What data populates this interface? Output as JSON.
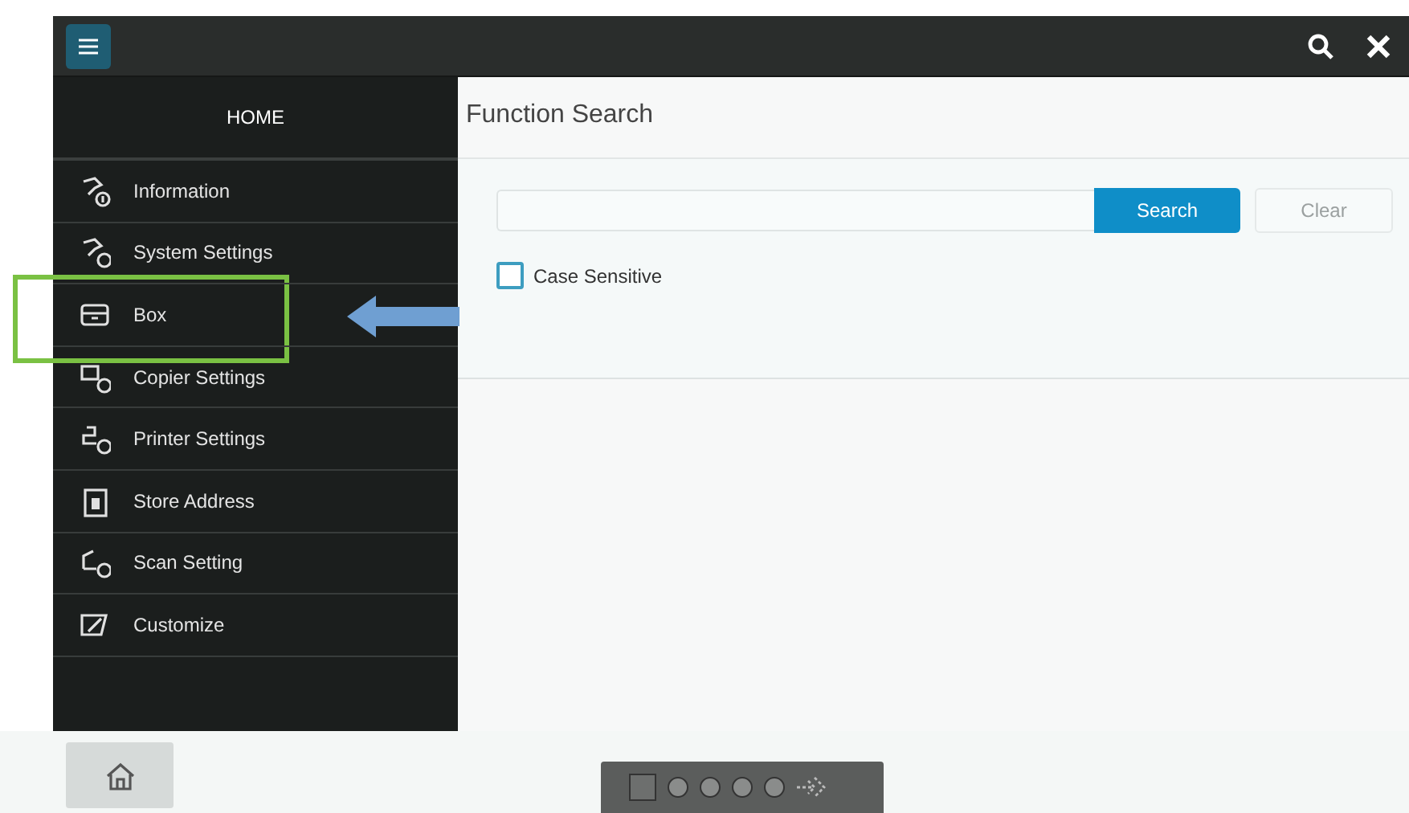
{
  "sidebar": {
    "title": "HOME",
    "items": [
      {
        "label": "Information",
        "kind": "info",
        "highlighted": false
      },
      {
        "label": "System Settings",
        "kind": "system",
        "highlighted": false
      },
      {
        "label": "Box",
        "kind": "box",
        "highlighted": true
      },
      {
        "label": "Copier Settings",
        "kind": "copier",
        "highlighted": false
      },
      {
        "label": "Printer Settings",
        "kind": "printer",
        "highlighted": false
      },
      {
        "label": "Store Address",
        "kind": "address",
        "highlighted": false
      },
      {
        "label": "Scan Setting",
        "kind": "scan",
        "highlighted": false
      },
      {
        "label": "Customize",
        "kind": "customize",
        "highlighted": false
      }
    ]
  },
  "function_search": {
    "title": "Function Search",
    "search_button": "Search",
    "clear_button": "Clear",
    "case_sensitive": {
      "label": "Case Sensitive",
      "checked": false
    }
  }
}
